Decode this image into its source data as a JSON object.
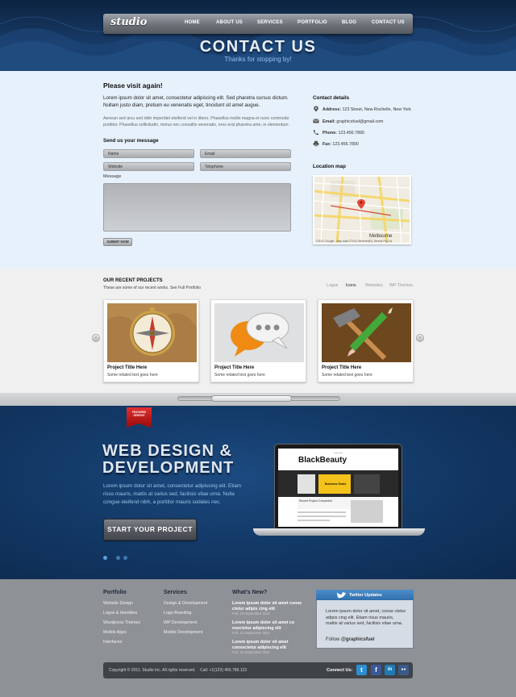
{
  "brand": {
    "logo": "studio"
  },
  "nav": {
    "items": [
      {
        "label": "HOME"
      },
      {
        "label": "ABOUT US"
      },
      {
        "label": "SERVICES"
      },
      {
        "label": "PORTFOLIO"
      },
      {
        "label": "BLOG"
      },
      {
        "label": "CONTACT US"
      }
    ]
  },
  "hero": {
    "title": "CONTACT US",
    "subtitle": "Thanks for stopping by!"
  },
  "visit": {
    "title": "Please visit again!",
    "lead": "Lorem ipsum dolor sit amet, consectetur adipiscing elit. Sed pharetra cursus dictum. Nullam justo diam, pretium eu venenatis eget, tincidunt sit amet augue.",
    "body": "Aenean sed arcu sed nibh imperdiet eleifend vel in libero. Phasellus mollis magna et nunc commodo porttitor. Phasellus sollicitudin, metus nec convallis venenatis, eros erat pharetra ante, in elementum"
  },
  "form": {
    "title": "Send us your message",
    "name_placeholder": "Name",
    "email_placeholder": "Email",
    "website_placeholder": "Website",
    "telephone_placeholder": "Telephone",
    "message_label": "Message",
    "submit_label": "SUBMIT NOW"
  },
  "contact_details": {
    "title": "Contact details",
    "address_label": "Address:",
    "address": "123 Street, New Rochelle, New York",
    "email_label": "Email:",
    "email": "graphicsfuel@gmail.com",
    "phone_label": "Phone:",
    "phone": "123.456.7890",
    "fax_label": "Fax:",
    "fax": "123.456.7890",
    "location_title": "Location map",
    "map_city": "Melbourne",
    "map_copyright": "©2011 Google - Map data ©2011 Whereis(R), Sensis Pty Ltd"
  },
  "projects": {
    "title": "OUR RECENT PROJECTS",
    "subtitle": "These are some of our recent works. See Full Portfolio",
    "filters": [
      "Logos",
      "Icons",
      "Websites",
      "WP Themes"
    ],
    "active_filter": "Icons",
    "cards": [
      {
        "title": "Project Title Here",
        "text": "Some related text goes here",
        "icon": "compass-icon"
      },
      {
        "title": "Project Title Here",
        "text": "Some related text goes here",
        "icon": "chat-bubbles-icon"
      },
      {
        "title": "Project Title Here",
        "text": "Some related text goes here",
        "icon": "hammer-pencil-icon"
      }
    ],
    "prev_arrow": "‹",
    "next_arrow": "›"
  },
  "featured": {
    "ribbon": "FEATURED SERVICE",
    "title_line1": "WEB DESIGN &",
    "title_line2": "DEVELOPMENT",
    "body": "Lorem ipsum dolor sit amet, consectetur adipiscing elit. Etiam risus mauris, mattis at varius sed, facilisis vitae urna. Nulla congue eleifend nibh, a porttitor mauris sodales nec.",
    "cta": "START YOUR PROJECT",
    "laptop_site": "BlackBeauty",
    "laptop_tagline": "Business Goals",
    "laptop_section": "Recent Project Completed",
    "slide_count": 3
  },
  "footer": {
    "portfolio_title": "Portfolio",
    "portfolio_links": [
      "Website Design",
      "Logos & Identities",
      "Wordpress Themes",
      "Mobile Apps",
      "Interfaces"
    ],
    "services_title": "Services",
    "services_links": [
      "Design & Development",
      "Logo Branding",
      "WP Development",
      "Mobile Development"
    ],
    "news_title": "What's New?",
    "news": [
      {
        "title": "Lorem ipsum dolor sit amet conse ctetur adipis cing elit",
        "date": "Fell, 16 September 2011"
      },
      {
        "title": "Lorem ipsum dolor sit amet co nsectetur adipiscing elit",
        "date": "Fell, 16 September 2011"
      },
      {
        "title": "Lorem ipsum dolor sit amet consectetur adipiscing elit",
        "date": "Fell, 16 September 2011"
      }
    ],
    "twitter_title": "Twitter Updates",
    "twitter_text": "Lorem ipsum dolor sit amet, conse ctetur adipis cing elit. Etiam risus mauris, mattis at varius sed, facilisis vitae urna.",
    "twitter_follow": "Follow",
    "twitter_handle": "@graphicsfuel",
    "copyright": "Copyright © 2011. Studio Inc. All rights reserved.",
    "call": "Call: +1(123) 456.789.123",
    "connect": "Connect Us:",
    "social": [
      {
        "icon": "twitter-icon",
        "glyph": "t",
        "color": "#2d8ed1"
      },
      {
        "icon": "facebook-icon",
        "glyph": "f",
        "color": "#3b5998"
      },
      {
        "icon": "linkedin-icon",
        "glyph": "in",
        "color": "#1f7bb6"
      },
      {
        "icon": "flickr-icon",
        "glyph": "●●",
        "color": "#3a5a8a"
      }
    ]
  },
  "colors": {
    "header_bg": "#14355f",
    "accent_blue": "#3e79b5",
    "footer_bg": "#8e9196"
  }
}
